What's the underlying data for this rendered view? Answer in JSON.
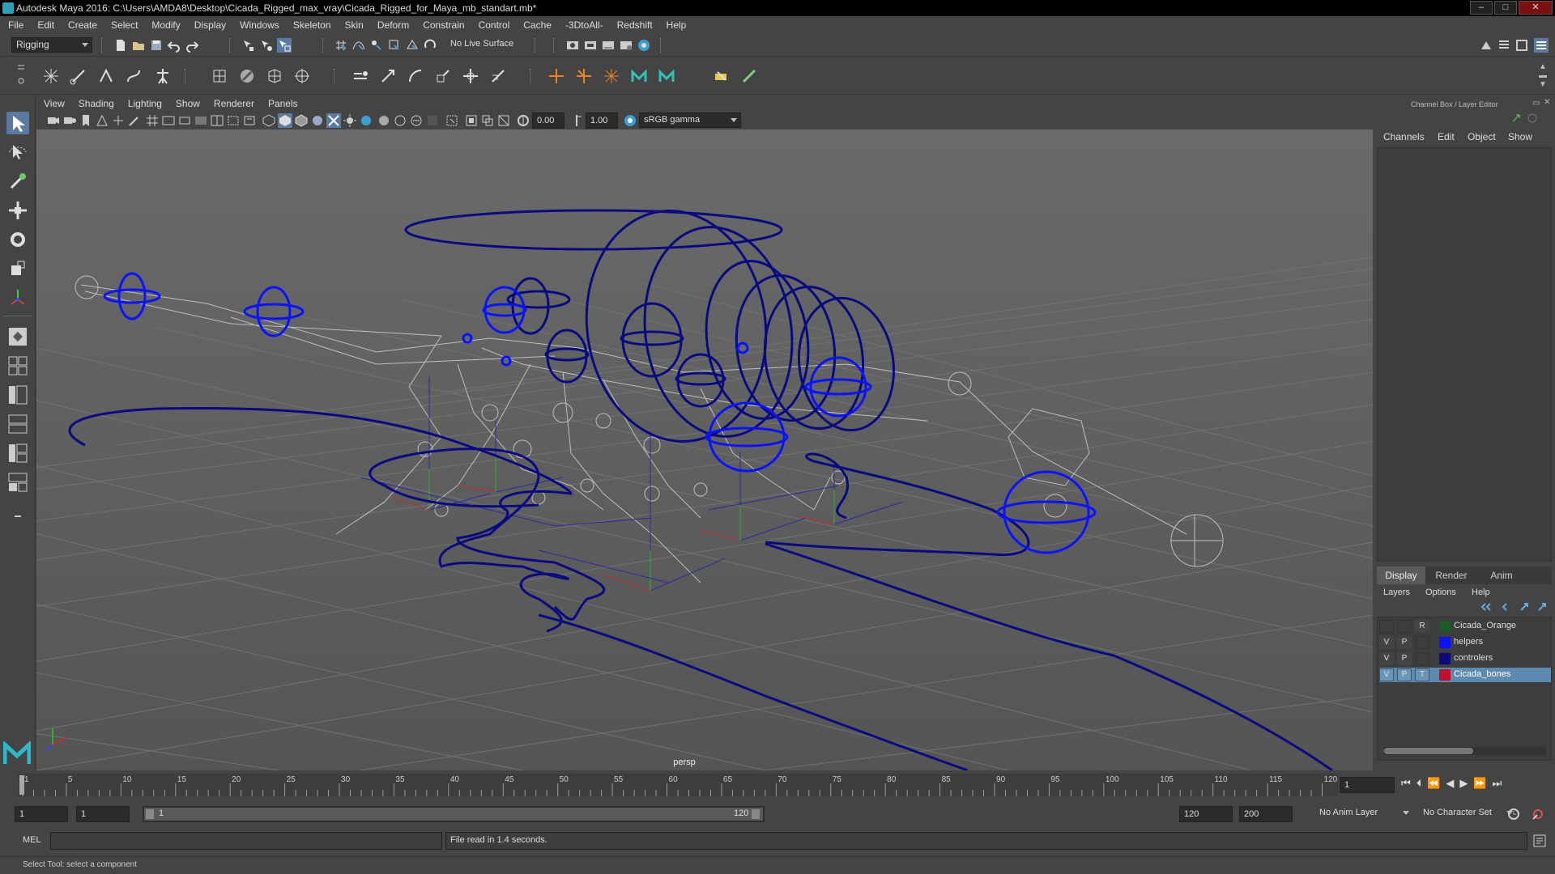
{
  "window": {
    "title": "Autodesk Maya 2016: C:\\Users\\AMDA8\\Desktop\\Cicada_Rigged_max_vray\\Cicada_Rigged_for_Maya_mb_standart.mb*",
    "minimize": "–",
    "maximize": "□",
    "close": "✕"
  },
  "menubar": [
    "File",
    "Edit",
    "Create",
    "Select",
    "Modify",
    "Display",
    "Windows",
    "Skeleton",
    "Skin",
    "Deform",
    "Constrain",
    "Control",
    "Cache",
    "-3DtoAll-",
    "Redshift",
    "Help"
  ],
  "statusline": {
    "menuset": "Rigging",
    "live_surface": "No Live Surface"
  },
  "panel": {
    "menus": [
      "View",
      "Shading",
      "Lighting",
      "Show",
      "Renderer",
      "Panels"
    ],
    "exposure": "0.00",
    "gamma": "1.00",
    "color_space": "sRGB gamma",
    "camera_label": "persp"
  },
  "channelbox": {
    "title": "Channel Box / Layer Editor",
    "menus": [
      "Channels",
      "Edit",
      "Object",
      "Show"
    ],
    "layer_tabs": [
      "Display",
      "Render",
      "Anim"
    ],
    "layer_menus": [
      "Layers",
      "Options",
      "Help"
    ],
    "layers": [
      {
        "v": "",
        "p": "",
        "t": "R",
        "color": "#1d5a2a",
        "name": "Cicada_Orange",
        "selected": false
      },
      {
        "v": "V",
        "p": "P",
        "t": "",
        "color": "#0a12ff",
        "name": "helpers",
        "selected": false
      },
      {
        "v": "V",
        "p": "P",
        "t": "",
        "color": "#0a0a7a",
        "name": "controlers",
        "selected": false
      },
      {
        "v": "V",
        "p": "P",
        "t": "T",
        "color": "#c01030",
        "name": "Cicada_bones",
        "selected": true
      }
    ]
  },
  "timeslider": {
    "ticks": [
      "1",
      "5",
      "10",
      "15",
      "20",
      "25",
      "30",
      "35",
      "40",
      "45",
      "50",
      "55",
      "60",
      "65",
      "70",
      "75",
      "80",
      "85",
      "90",
      "95",
      "100",
      "105",
      "110",
      "115",
      "120"
    ],
    "current_frame": "1"
  },
  "range": {
    "start": "1",
    "playback_start": "1",
    "slider_start": "1",
    "slider_end": "120",
    "playback_end": "120",
    "end": "200",
    "anim_layer": "No Anim Layer",
    "character_set": "No Character Set"
  },
  "cmdline": {
    "lang": "MEL",
    "result": "File read in  1.4 seconds."
  },
  "helpline": "Select Tool: select a component",
  "colors": {
    "ctrl_blue": "#0a12ff",
    "ctrl_dark": "#0a0a80",
    "bone_gray": "#c8c8c8",
    "grid": "#6b6b6b"
  }
}
